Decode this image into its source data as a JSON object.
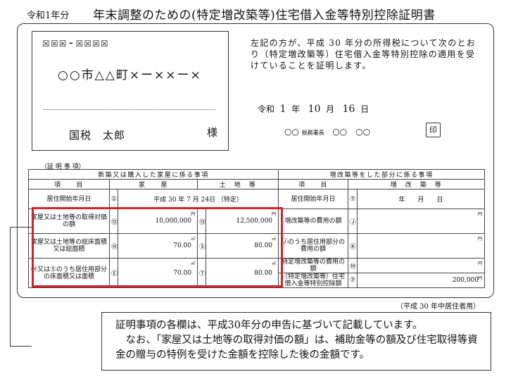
{
  "header": {
    "era_label": "令和1年分",
    "title": "年末調整のための(特定増改築等)住宅借入金等特別控除証明書"
  },
  "address": {
    "postal": "☒☒☒-☒☒☒☒",
    "line": "○○市△△町×ー××ー×",
    "name": "国税　太郎",
    "honorific": "様"
  },
  "certification": {
    "text": "左記の方が、平成 30 年分の所得税について次のとおり（特定増改築等）住宅借入金等特別控除の適用を受けていることを証明します。",
    "date": {
      "era": "令和",
      "year": "1",
      "year_unit": "年",
      "month": "10",
      "month_unit": "月",
      "day": "16",
      "day_unit": "日"
    },
    "office": "○○",
    "office_title": "税務署長",
    "official_name": "○○　○○",
    "seal": "印"
  },
  "section_title": "（証 明 事 項）",
  "table": {
    "left_header": "新築又は購入した家屋に係る事項",
    "right_header": "増改築等をした部分に係る事項",
    "col_item": "項　　目",
    "col_house": "家　　屋",
    "col_land": "土　地　等",
    "col_renov": "増　改　築　等",
    "rows": [
      {
        "label": "居住開始年月日",
        "n1": "①",
        "move_in": "平成 30 年 7 月 24日 （特定）",
        "right_label": "居住開始年月日",
        "n_r": "⑦",
        "right_value": "年　　月　　日"
      },
      {
        "label": "家屋又は土地等の取得対価の額",
        "n1": "⑫",
        "house": "10,000,000",
        "house_unit": "円",
        "n2": "⑬",
        "land": "12,500,000",
        "land_unit": "円",
        "right_label": "増改築等の費用の額",
        "n_r": "Ⓙ",
        "right_value": "",
        "right_unit": "円"
      },
      {
        "label": "家屋又は土地等の総床面積又は総面積",
        "n1": "Ⓗ",
        "house": "70.00",
        "house_unit": "㎡",
        "n2": "Ⓢ",
        "land": "80.00",
        "land_unit": "㎡",
        "right_label": "Ⓙのうち居住用部分の費用の額",
        "n_r": "Ⓚ",
        "right_value": "",
        "right_unit": "円"
      },
      {
        "label": "Ⓗ又はⓈのうち居住用部分の床面積又は面積",
        "n1": "Ⓔ",
        "house": "70.00",
        "house_unit": "㎡",
        "n2": "Ⓣ",
        "land": "80.00",
        "land_unit": "㎡",
        "right_label": "特定増改築等の費用の額",
        "n_r": "Ⓜ",
        "right_value": "",
        "right_unit": "円"
      },
      {
        "label": "",
        "right_label": "（特定増改築等）住宅借入金等特別控除額",
        "n_r": "⑦",
        "right_value": "200,000",
        "right_unit": "円"
      }
    ]
  },
  "footer_note": "（平成 30 年中居住者用）",
  "callout": {
    "line1": "証明事項の各欄は、平成30年分の申告に基づいて記載しています。",
    "line2": "　なお、「家屋又は土地等の取得対価の額」は、補助金等の額及び住宅取得等資金の贈与の特例を受けた金額を控除した後の金額です。"
  }
}
